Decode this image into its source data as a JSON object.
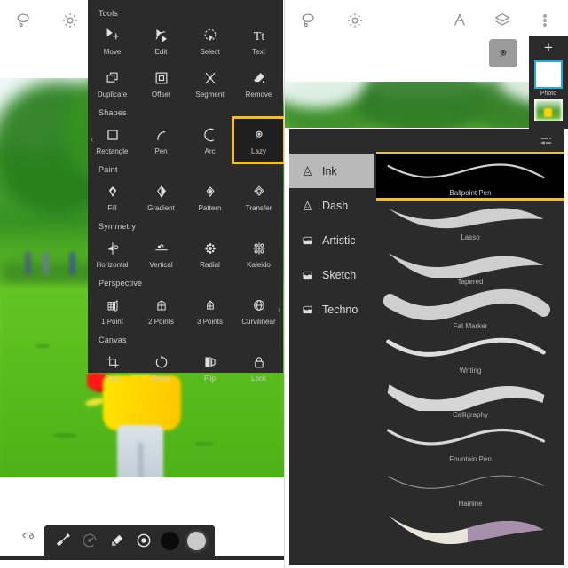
{
  "left_screen": {
    "top_icons": [
      {
        "name": "lasso-select-icon",
        "label": "Lasso Select"
      },
      {
        "name": "gear-icon",
        "label": "Settings"
      }
    ],
    "tools_panel": {
      "title": "Tools",
      "sections": [
        {
          "heading": "",
          "items": [
            {
              "label": "Move",
              "icon": "move-icon"
            },
            {
              "label": "Edit",
              "icon": "edit-icon"
            },
            {
              "label": "Select",
              "icon": "select-icon"
            },
            {
              "label": "Text",
              "icon": "text-icon"
            }
          ]
        },
        {
          "heading": "",
          "items": [
            {
              "label": "Duplicate",
              "icon": "duplicate-icon"
            },
            {
              "label": "Offset",
              "icon": "offset-icon"
            },
            {
              "label": "Segment",
              "icon": "segment-icon"
            },
            {
              "label": "Remove",
              "icon": "remove-icon"
            }
          ]
        },
        {
          "heading": "Shapes",
          "items": [
            {
              "label": "Rectangle",
              "icon": "rectangle-icon"
            },
            {
              "label": "Pen",
              "icon": "pen-icon"
            },
            {
              "label": "Arc",
              "icon": "arc-icon"
            },
            {
              "label": "Lazy",
              "icon": "lazy-icon",
              "selected": true
            }
          ]
        },
        {
          "heading": "Paint",
          "items": [
            {
              "label": "Fill",
              "icon": "fill-icon"
            },
            {
              "label": "Gradient",
              "icon": "gradient-icon"
            },
            {
              "label": "Pattern",
              "icon": "pattern-icon"
            },
            {
              "label": "Transfer",
              "icon": "transfer-icon"
            }
          ]
        },
        {
          "heading": "Symmetry",
          "items": [
            {
              "label": "Horizontal",
              "icon": "symmetry-horizontal-icon"
            },
            {
              "label": "Vertical",
              "icon": "symmetry-vertical-icon"
            },
            {
              "label": "Radial",
              "icon": "symmetry-radial-icon"
            },
            {
              "label": "Kaleido",
              "icon": "symmetry-kaleido-icon"
            }
          ]
        },
        {
          "heading": "Perspective",
          "items": [
            {
              "label": "1 Point",
              "icon": "perspective-1-point-icon"
            },
            {
              "label": "2 Points",
              "icon": "perspective-2-points-icon"
            },
            {
              "label": "3 Points",
              "icon": "perspective-3-points-icon"
            },
            {
              "label": "Curvilinear",
              "icon": "perspective-curvilinear-icon"
            }
          ]
        },
        {
          "heading": "Canvas",
          "items": [
            {
              "label": "Crop",
              "icon": "crop-icon"
            },
            {
              "label": "Reset",
              "icon": "reset-icon"
            },
            {
              "label": "Flip",
              "icon": "flip-icon"
            },
            {
              "label": "Lock",
              "icon": "lock-icon"
            }
          ]
        }
      ],
      "prev_arrow": "‹",
      "next_arrow": "›",
      "selected_color": "#f6bf1a",
      "background_color": "#2b2b2b"
    },
    "bottom_toolbar": {
      "undo_icon": "undo-icon",
      "items": [
        {
          "name": "brush-tool-icon",
          "label": "Brush"
        },
        {
          "name": "smudge-tool-icon",
          "label": "Smudge"
        },
        {
          "name": "eraser-tool-icon",
          "label": "Eraser"
        },
        {
          "name": "brush-size-icon",
          "label": "Brush Size"
        },
        {
          "name": "color-swatch-dark",
          "label": "Black",
          "color": "#0b0b0b"
        },
        {
          "name": "color-swatch-light",
          "label": "Light Gray",
          "color": "#c9c9c9"
        }
      ]
    }
  },
  "right_screen": {
    "top_left_icons": [
      {
        "name": "lasso-select-icon",
        "label": "Lasso Select"
      },
      {
        "name": "gear-icon",
        "label": "Settings"
      }
    ],
    "top_right_icons": [
      {
        "name": "compass-icon",
        "label": "Navigate"
      },
      {
        "name": "layers-icon",
        "label": "Layers"
      },
      {
        "name": "overflow-menu-icon",
        "label": "More"
      }
    ],
    "lazy_button": {
      "name": "lazy-tool-button",
      "label": "Lazy",
      "active": true
    },
    "layers_panel": {
      "add_label": "+",
      "layers": [
        {
          "label": "Photo",
          "selected": true
        },
        {
          "label": "",
          "selected": false
        }
      ],
      "selected_border_color": "#29a8e0"
    },
    "brush_panel": {
      "settings_icon": "sliders-icon",
      "categories": [
        {
          "label": "Ink",
          "icon": "ink-nib-icon",
          "active": true
        },
        {
          "label": "Dash",
          "icon": "dash-nib-icon",
          "active": false
        },
        {
          "label": "Artistic",
          "icon": "artistic-bucket-icon",
          "active": false
        },
        {
          "label": "Sketch",
          "icon": "sketch-bucket-icon",
          "active": false
        },
        {
          "label": "Techno",
          "icon": "techno-bucket-icon",
          "active": false
        }
      ],
      "brushes": [
        {
          "label": "Ballpoint Pen",
          "selected": true
        },
        {
          "label": "Lasso",
          "selected": false
        },
        {
          "label": "Tapered",
          "selected": false
        },
        {
          "label": "Fat Marker",
          "selected": false
        },
        {
          "label": "Writing",
          "selected": false
        },
        {
          "label": "Calligraphy",
          "selected": false
        },
        {
          "label": "Fountain Pen",
          "selected": false
        },
        {
          "label": "Hairline",
          "selected": false
        },
        {
          "label": "",
          "selected": false
        }
      ],
      "selected_color": "#f6bf1a",
      "active_category_bg": "#b9b9b9"
    }
  }
}
